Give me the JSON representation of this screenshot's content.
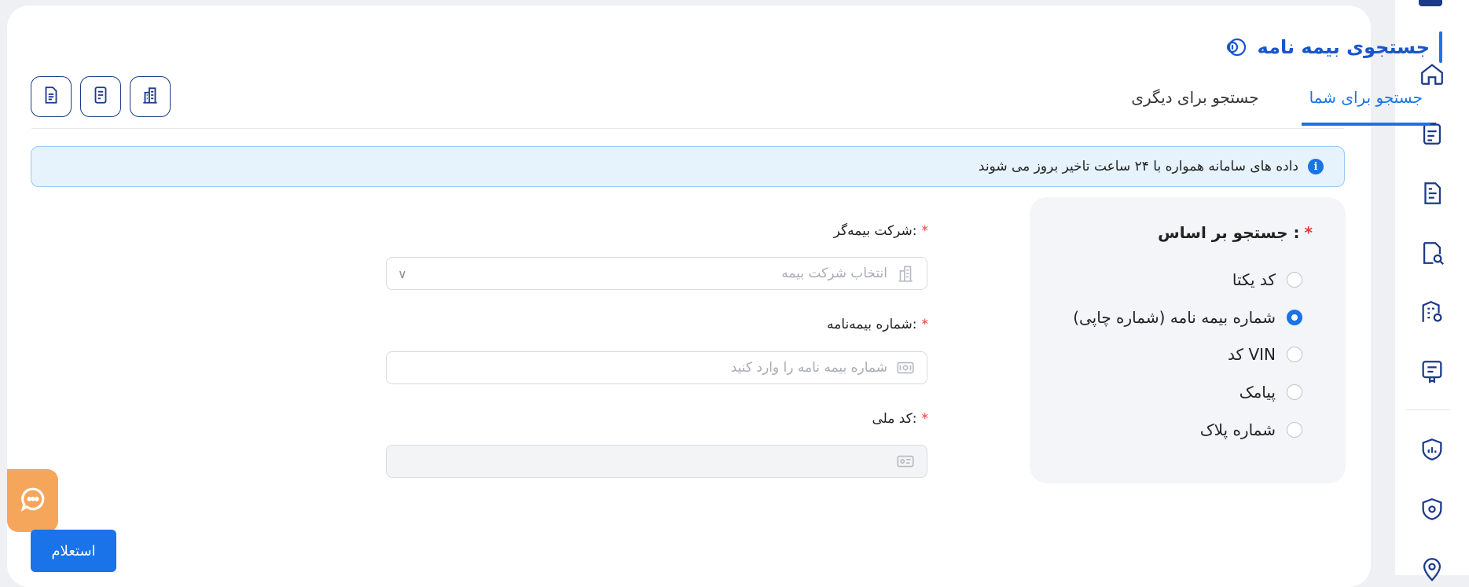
{
  "header": {
    "title": "جستجوی بیمه نامه"
  },
  "tabs": [
    {
      "label": "جستجو برای شما",
      "active": true
    },
    {
      "label": "جستجو برای دیگری",
      "active": false
    }
  ],
  "toolbar_icons": [
    "document-icon",
    "receipt-icon",
    "building-icon"
  ],
  "alert": {
    "text": "داده های سامانه همواره با ۲۴ ساعت تاخیر بروز می شوند"
  },
  "search_by": {
    "label": "جستجو بر اساس :",
    "options": [
      {
        "label": "کد یکتا",
        "checked": false
      },
      {
        "label": "شماره بیمه نامه (شماره چاپی)",
        "checked": true
      },
      {
        "label": "کد VIN",
        "checked": false
      },
      {
        "label": "پیامک",
        "checked": false
      },
      {
        "label": "شماره پلاک",
        "checked": false
      }
    ]
  },
  "form": {
    "insurer_label": "شرکت بیمه‌گر:",
    "insurer_placeholder": "انتخاب شرکت بیمه",
    "policy_label": "شماره بیمه‌نامه:",
    "policy_placeholder": "شماره بیمه نامه را وارد کنید",
    "national_code_label": "کد ملی:",
    "national_code_value": ""
  },
  "required_mark": "*",
  "submit_label": "استعلام",
  "colors": {
    "accent": "#1a73e8",
    "sidebar_icon": "#1c3a8a",
    "chat_button": "#f5a65b",
    "alert_bg": "#e6f3fd",
    "required": "#e53935"
  }
}
